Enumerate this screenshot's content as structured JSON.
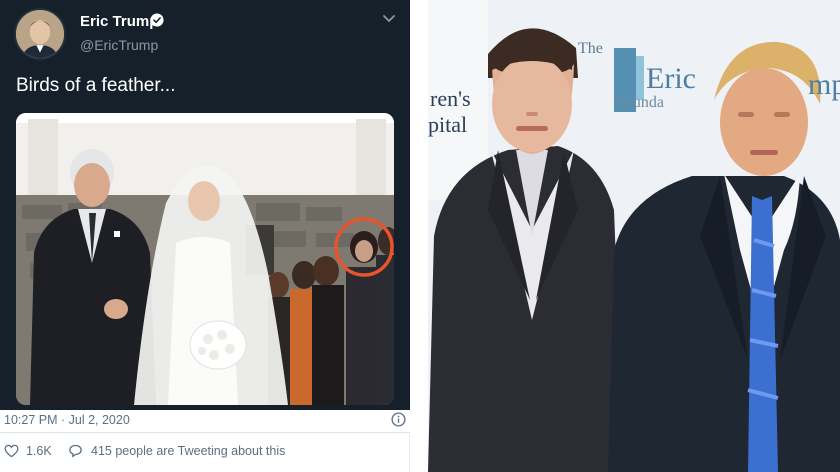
{
  "tweet": {
    "display_name": "Eric Trump",
    "handle": "@EricTrump",
    "text": "Birds of a feather...",
    "timestamp": "10:27 PM · Jul 2, 2020",
    "like_count": "1.6K",
    "tweeting_text": "415 people are Tweeting about this",
    "icons": {
      "verified": "verified-badge-icon",
      "caret": "chevron-down-icon",
      "info": "info-icon",
      "like": "heart-icon",
      "reply": "speech-bubble-icon"
    },
    "colors": {
      "background": "#15202b",
      "text": "#ffffff",
      "secondary": "#8899a6",
      "meta": "#5b7083",
      "highlight_circle": "#e8542b"
    }
  },
  "photo": {
    "backdrop_lines": [
      "ren's",
      "pital",
      "The",
      "Eric",
      "Founda",
      "mp"
    ]
  }
}
